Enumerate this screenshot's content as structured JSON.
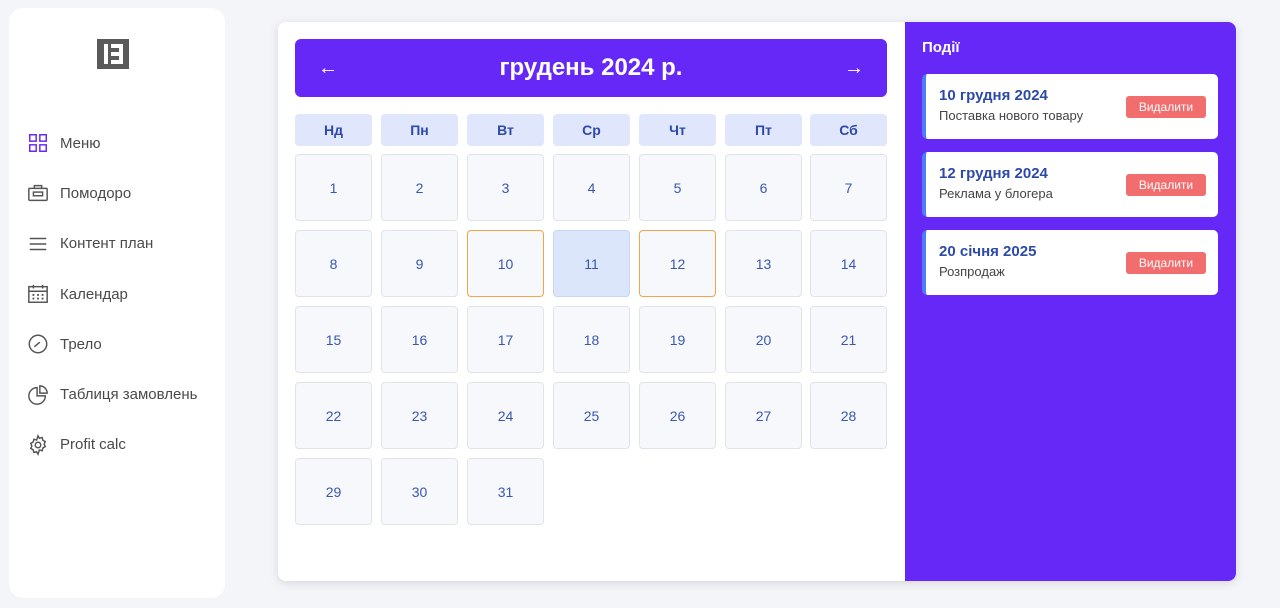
{
  "sidebar": {
    "logo_icon": "logo-icon",
    "items": [
      {
        "label": "Меню",
        "icon": "grid-icon"
      },
      {
        "label": "Помодоро",
        "icon": "briefcase-icon"
      },
      {
        "label": "Контент план",
        "icon": "menu-lines-icon"
      },
      {
        "label": "Календар",
        "icon": "calendar-icon"
      },
      {
        "label": "Трело",
        "icon": "check-circle-icon"
      },
      {
        "label": "Таблиця замовлень",
        "icon": "pie-chart-icon"
      },
      {
        "label": "Profit calc",
        "icon": "gear-icon"
      }
    ]
  },
  "calendar": {
    "prev_label": "←",
    "next_label": "→",
    "month_title": "грудень 2024 р.",
    "weekdays": [
      "Нд",
      "Пн",
      "Вт",
      "Ср",
      "Чт",
      "Пт",
      "Сб"
    ],
    "days": [
      "1",
      "2",
      "3",
      "4",
      "5",
      "6",
      "7",
      "8",
      "9",
      "10",
      "11",
      "12",
      "13",
      "14",
      "15",
      "16",
      "17",
      "18",
      "19",
      "20",
      "21",
      "22",
      "23",
      "24",
      "25",
      "26",
      "27",
      "28",
      "29",
      "30",
      "31"
    ],
    "event_days": [
      "10",
      "12"
    ],
    "today": "11"
  },
  "events": {
    "title": "Події",
    "delete_label": "Видалити",
    "items": [
      {
        "date": "10 грудня 2024",
        "description": "Поставка нового товару"
      },
      {
        "date": "12 грудня 2024",
        "description": "Реклама у блогера"
      },
      {
        "date": "20 січня 2025",
        "description": "Розпродаж"
      }
    ]
  },
  "colors": {
    "accent": "#6528f7",
    "event_border": "#f0a54b",
    "today_bg": "#dbe6fb",
    "delete": "#f26d6d",
    "day_text": "#3a57b0"
  }
}
